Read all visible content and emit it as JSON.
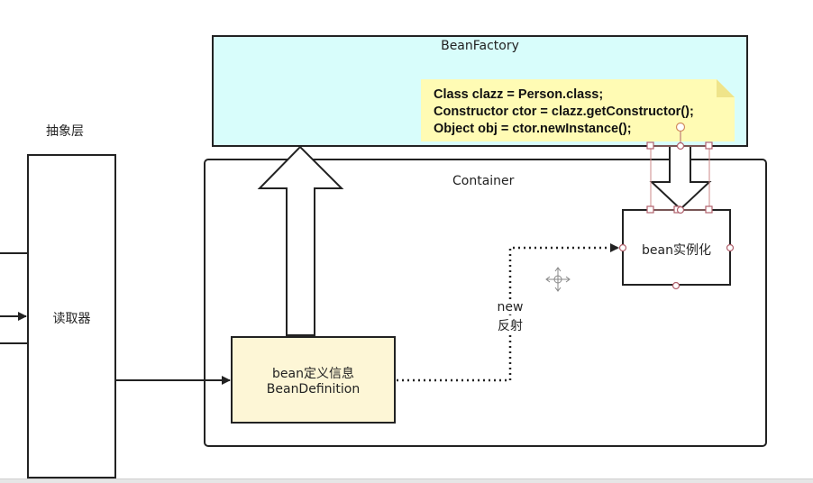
{
  "diagram": {
    "bean_factory": {
      "label": "BeanFactory"
    },
    "abstraction_layer": {
      "label": "抽象层"
    },
    "reader": {
      "label": "读取器"
    },
    "container": {
      "label": "Container"
    },
    "bean_definition": {
      "line1": "bean定义信息",
      "line2": "BeanDefinition"
    },
    "bean_instantiation": {
      "label": "bean实例化"
    },
    "reflection_edge": {
      "line1": "new",
      "line2": "反射"
    },
    "code_note": {
      "lines": [
        "Class clazz = Person.class;",
        "Constructor ctor = clazz.getConstructor();",
        "Object obj = ctor.newInstance();"
      ]
    }
  },
  "colors": {
    "bean_factory_fill": "#d8fdfb",
    "bean_definition_fill": "#fdf6d6",
    "note_fill": "#fffbb4",
    "stroke": "#222222",
    "selection_handle": "#b0606c"
  }
}
